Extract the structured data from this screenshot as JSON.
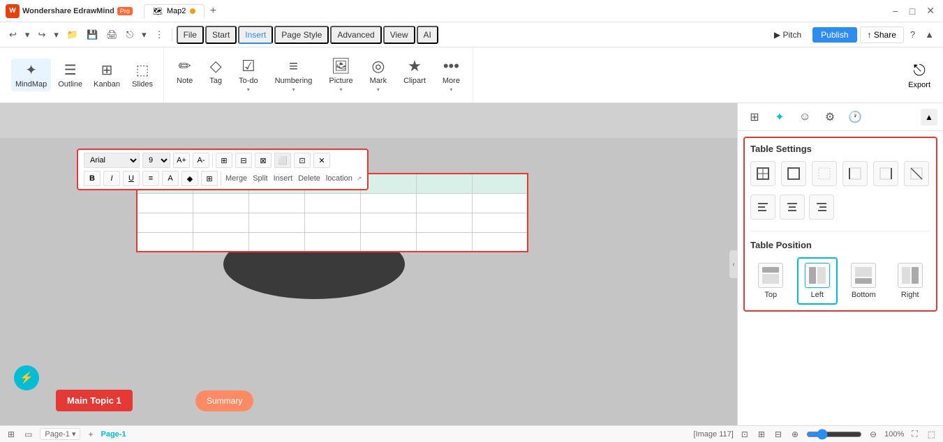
{
  "app": {
    "name": "Wondershare EdrawMind",
    "pro_badge": "Pro",
    "tab_name": "Map2",
    "tab_modified": true
  },
  "window_controls": {
    "minimize": "−",
    "maximize": "□",
    "close": "✕"
  },
  "menu": {
    "items": [
      "File",
      "Start",
      "Insert",
      "Page Style",
      "Advanced",
      "View",
      "AI"
    ],
    "active": "Insert"
  },
  "toolbar_left": {
    "undo": "↩",
    "redo": "↪"
  },
  "ribbon": {
    "groups": [
      {
        "id": "mindmap",
        "icon": "✦",
        "label": "MindMap"
      },
      {
        "id": "outline",
        "icon": "☰",
        "label": "Outline"
      },
      {
        "id": "kanban",
        "icon": "⊞",
        "label": "Kanban"
      },
      {
        "id": "slides",
        "icon": "⬚",
        "label": "Slides"
      }
    ],
    "tools": [
      {
        "id": "note",
        "icon": "✏",
        "label": "Note"
      },
      {
        "id": "tag",
        "icon": "◇",
        "label": "Tag"
      },
      {
        "id": "todo",
        "icon": "☑",
        "label": "To-do"
      },
      {
        "id": "numbering",
        "icon": "≡",
        "label": "Numbering"
      },
      {
        "id": "picture",
        "icon": "🖼",
        "label": "Picture"
      },
      {
        "id": "mark",
        "icon": "◎",
        "label": "Mark"
      },
      {
        "id": "clipart",
        "icon": "★",
        "label": "Clipart"
      },
      {
        "id": "more",
        "icon": "•••",
        "label": "More"
      }
    ],
    "export": {
      "icon": "⎋",
      "label": "Export"
    }
  },
  "right_menu": {
    "pitch": "Pitch",
    "publish": "Publish",
    "share": "Share",
    "help": "?"
  },
  "floating_toolbar": {
    "font": "Arial",
    "font_size": "9",
    "grow": "A+",
    "shrink": "A-",
    "bold": "B",
    "italic": "I",
    "underline": "U",
    "merge": "Merge",
    "split": "Split",
    "insert": "Insert",
    "delete": "Delete",
    "location": "location"
  },
  "panel": {
    "tabs": [
      {
        "id": "table",
        "icon": "⊞",
        "label": "Table"
      },
      {
        "id": "magic",
        "icon": "✦",
        "label": "Magic",
        "active": true
      },
      {
        "id": "emoji",
        "icon": "☺",
        "label": "Emoji"
      },
      {
        "id": "settings",
        "icon": "⚙",
        "label": "Settings"
      },
      {
        "id": "history",
        "icon": "🕐",
        "label": "History"
      }
    ],
    "table_settings": {
      "title": "Table Settings",
      "buttons": [
        "⊞",
        "⊟",
        "⊠",
        "⊡",
        "⊢",
        "⊣"
      ],
      "align_buttons": [
        "≡",
        "≣",
        "≡"
      ]
    },
    "table_position": {
      "title": "Table Position",
      "positions": [
        {
          "id": "top",
          "icon": "⬆",
          "label": "Top"
        },
        {
          "id": "left",
          "icon": "⬅",
          "label": "Left",
          "active": true
        },
        {
          "id": "bottom",
          "icon": "⬇",
          "label": "Bottom"
        },
        {
          "id": "right",
          "icon": "➡",
          "label": "Right"
        }
      ]
    }
  },
  "canvas": {
    "topic_label": "Main Topic 1",
    "summary_label": "Summary"
  },
  "status_bar": {
    "page_info": "[Image 117]",
    "page_name": "Page-1",
    "add_page": "+",
    "zoom": "100%",
    "fit_page": "⊞",
    "fullscreen": "⛶"
  }
}
